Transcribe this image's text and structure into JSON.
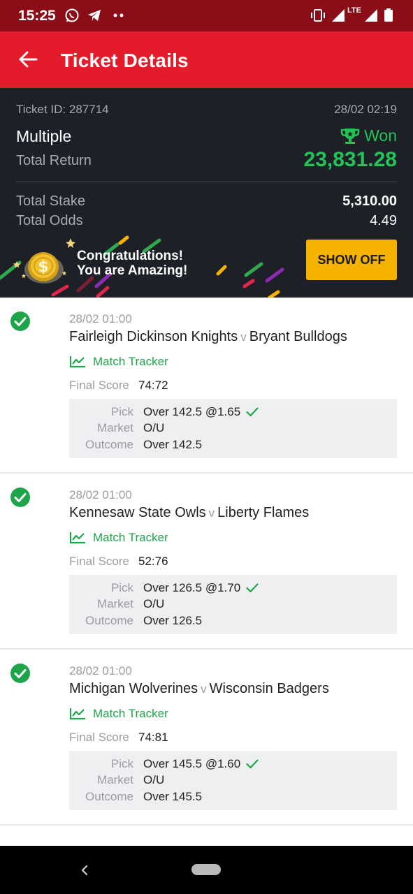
{
  "status_bar": {
    "time": "15:25",
    "network": "LTE"
  },
  "app_bar": {
    "title": "Ticket Details"
  },
  "summary": {
    "ticket_id": "Ticket ID: 287714",
    "date": "28/02 02:19",
    "bet_type": "Multiple",
    "status": "Won",
    "total_return_label": "Total Return",
    "total_return": "23,831.28",
    "total_stake_label": "Total Stake",
    "total_stake": "5,310.00",
    "total_odds_label": "Total Odds",
    "total_odds": "4.49"
  },
  "banner": {
    "line1": "Congratulations!",
    "line2": "You are Amazing!",
    "button": "SHOW OFF"
  },
  "labels": {
    "match_tracker": "Match Tracker",
    "final_score": "Final Score",
    "pick": "Pick",
    "market": "Market",
    "outcome": "Outcome",
    "versus": "v"
  },
  "bets": [
    {
      "kickoff": "28/02 01:00",
      "home": "Fairleigh Dickinson Knights",
      "away": "Bryant Bulldogs",
      "final_score": "74:72",
      "pick": "Over 142.5 @1.65",
      "market": "O/U",
      "outcome": "Over 142.5"
    },
    {
      "kickoff": "28/02 01:00",
      "home": "Kennesaw State Owls",
      "away": "Liberty Flames",
      "final_score": "52:76",
      "pick": "Over 126.5 @1.70",
      "market": "O/U",
      "outcome": "Over 126.5"
    },
    {
      "kickoff": "28/02 01:00",
      "home": "Michigan Wolverines",
      "away": "Wisconsin Badgers",
      "final_score": "74:81",
      "pick": "Over 145.5 @1.60",
      "market": "O/U",
      "outcome": "Over 145.5"
    }
  ],
  "colors": {
    "status_bar": "#8a0d17",
    "app_bar": "#e41b2a",
    "summary_bg": "#1d2027",
    "won_green": "#21c455",
    "tracker_green": "#1ea54a",
    "button_yellow": "#f5b300"
  },
  "icons": [
    "back-arrow-icon",
    "whatsapp-icon",
    "telegram-icon",
    "vibrate-icon",
    "signal-icon",
    "battery-icon",
    "trophy-icon",
    "coin-icon",
    "check-circle-icon",
    "chart-line-icon",
    "checkmark-icon",
    "nav-back-icon"
  ]
}
